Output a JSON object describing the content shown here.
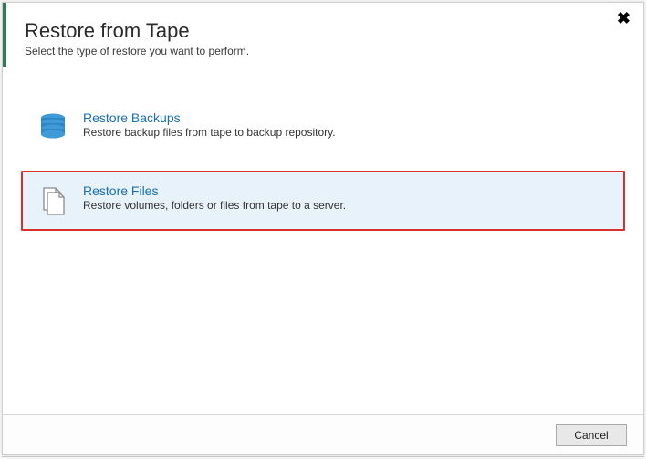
{
  "header": {
    "title": "Restore from Tape",
    "subtitle": "Select the type of restore you want to perform."
  },
  "options": [
    {
      "icon": "database-icon",
      "title": "Restore Backups",
      "description": "Restore backup files from tape to backup repository.",
      "selected": false
    },
    {
      "icon": "files-icon",
      "title": "Restore Files",
      "description": "Restore volumes, folders or files from tape to a server.",
      "selected": true
    }
  ],
  "footer": {
    "cancel_label": "Cancel"
  },
  "close_glyph": "✖"
}
